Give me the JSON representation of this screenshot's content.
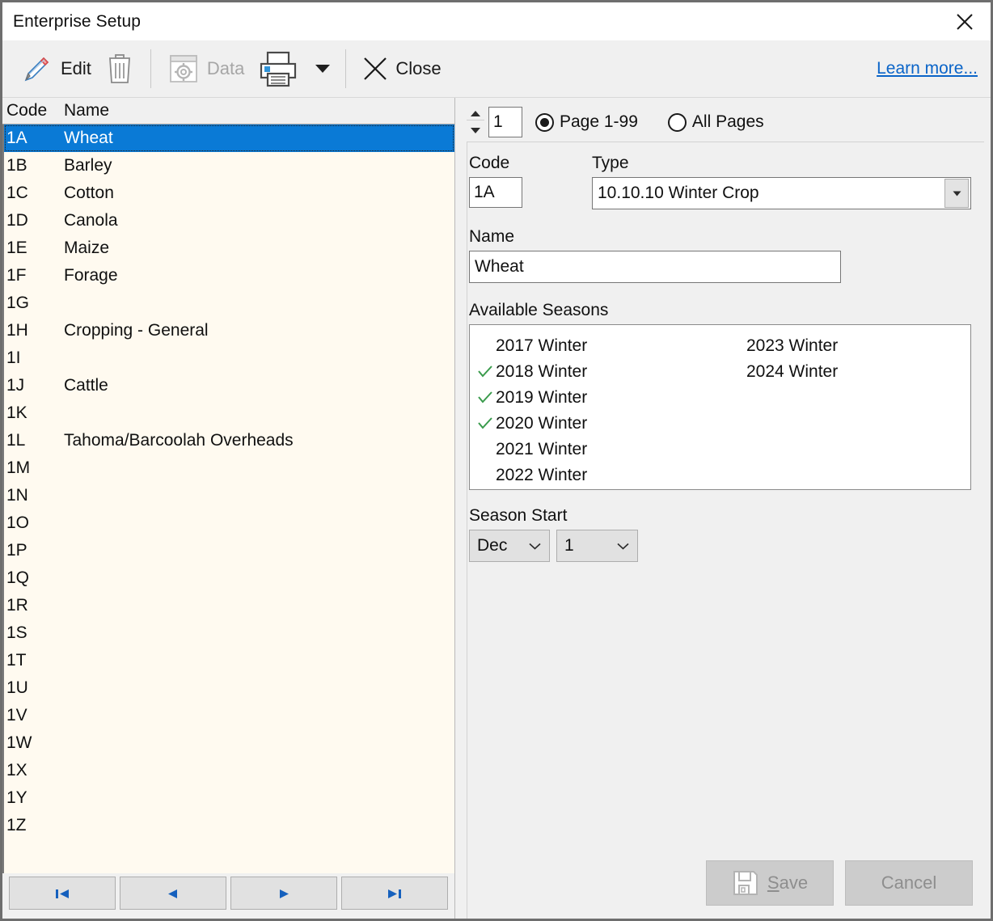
{
  "window": {
    "title": "Enterprise Setup",
    "close_icon": "close-x-icon"
  },
  "toolbar": {
    "edit_label": "Edit",
    "edit_icon": "pencil-icon",
    "delete_icon": "trash-icon",
    "data_label": "Data",
    "data_icon": "window-gear-icon",
    "print_icon": "printer-icon",
    "print_caret_icon": "caret-down-icon",
    "close_label": "Close",
    "close_icon": "x-icon",
    "learn_more_label": "Learn more..."
  },
  "list": {
    "header": {
      "code": "Code",
      "name": "Name"
    },
    "selected_index": 0,
    "rows": [
      {
        "code": "1A",
        "name": "Wheat"
      },
      {
        "code": "1B",
        "name": "Barley"
      },
      {
        "code": "1C",
        "name": "Cotton"
      },
      {
        "code": "1D",
        "name": "Canola"
      },
      {
        "code": "1E",
        "name": "Maize"
      },
      {
        "code": "1F",
        "name": "Forage"
      },
      {
        "code": "1G",
        "name": ""
      },
      {
        "code": "1H",
        "name": "Cropping - General"
      },
      {
        "code": "1I",
        "name": ""
      },
      {
        "code": "1J",
        "name": "Cattle"
      },
      {
        "code": "1K",
        "name": ""
      },
      {
        "code": "1L",
        "name": "Tahoma/Barcoolah Overheads"
      },
      {
        "code": "1M",
        "name": ""
      },
      {
        "code": "1N",
        "name": ""
      },
      {
        "code": "1O",
        "name": ""
      },
      {
        "code": "1P",
        "name": ""
      },
      {
        "code": "1Q",
        "name": ""
      },
      {
        "code": "1R",
        "name": ""
      },
      {
        "code": "1S",
        "name": ""
      },
      {
        "code": "1T",
        "name": ""
      },
      {
        "code": "1U",
        "name": ""
      },
      {
        "code": "1V",
        "name": ""
      },
      {
        "code": "1W",
        "name": ""
      },
      {
        "code": "1X",
        "name": ""
      },
      {
        "code": "1Y",
        "name": ""
      },
      {
        "code": "1Z",
        "name": ""
      }
    ],
    "nav": {
      "first_icon": "first-record-icon",
      "prev_icon": "previous-record-icon",
      "next_icon": "next-record-icon",
      "last_icon": "last-record-icon"
    }
  },
  "page_selector": {
    "value": "1",
    "spinner_up_icon": "spinner-up-icon",
    "spinner_down_icon": "spinner-down-icon",
    "page_range_label": "Page 1-99",
    "all_pages_label": "All Pages",
    "selected": "page_range"
  },
  "form": {
    "code_label": "Code",
    "code_value": "1A",
    "type_label": "Type",
    "type_value": "10.10.10 Winter Crop",
    "type_arrow_icon": "dropdown-arrow-icon",
    "name_label": "Name",
    "name_value": "Wheat",
    "seasons_label": "Available Seasons",
    "seasons": [
      {
        "label": "2017 Winter",
        "checked": false
      },
      {
        "label": "2018 Winter",
        "checked": true
      },
      {
        "label": "2019 Winter",
        "checked": true
      },
      {
        "label": "2020 Winter",
        "checked": true
      },
      {
        "label": "2021 Winter",
        "checked": false
      },
      {
        "label": "2022 Winter",
        "checked": false
      },
      {
        "label": "2023 Winter",
        "checked": false
      },
      {
        "label": "2024 Winter",
        "checked": false
      }
    ],
    "check_icon": "green-check-icon",
    "season_start_label": "Season Start",
    "season_start_month": "Dec",
    "season_start_day": "1",
    "chevron_icon": "chevron-down-icon"
  },
  "footer": {
    "save_label": "ave",
    "save_accel": "S",
    "save_icon": "floppy-disk-icon",
    "cancel_label": "Cancel"
  },
  "colors": {
    "selection_blue": "#0a7ad6",
    "list_background": "#fffaf0",
    "link_blue": "#0a64c8",
    "check_green": "#3a9b4c",
    "panel_gray": "#f0f0f0"
  }
}
